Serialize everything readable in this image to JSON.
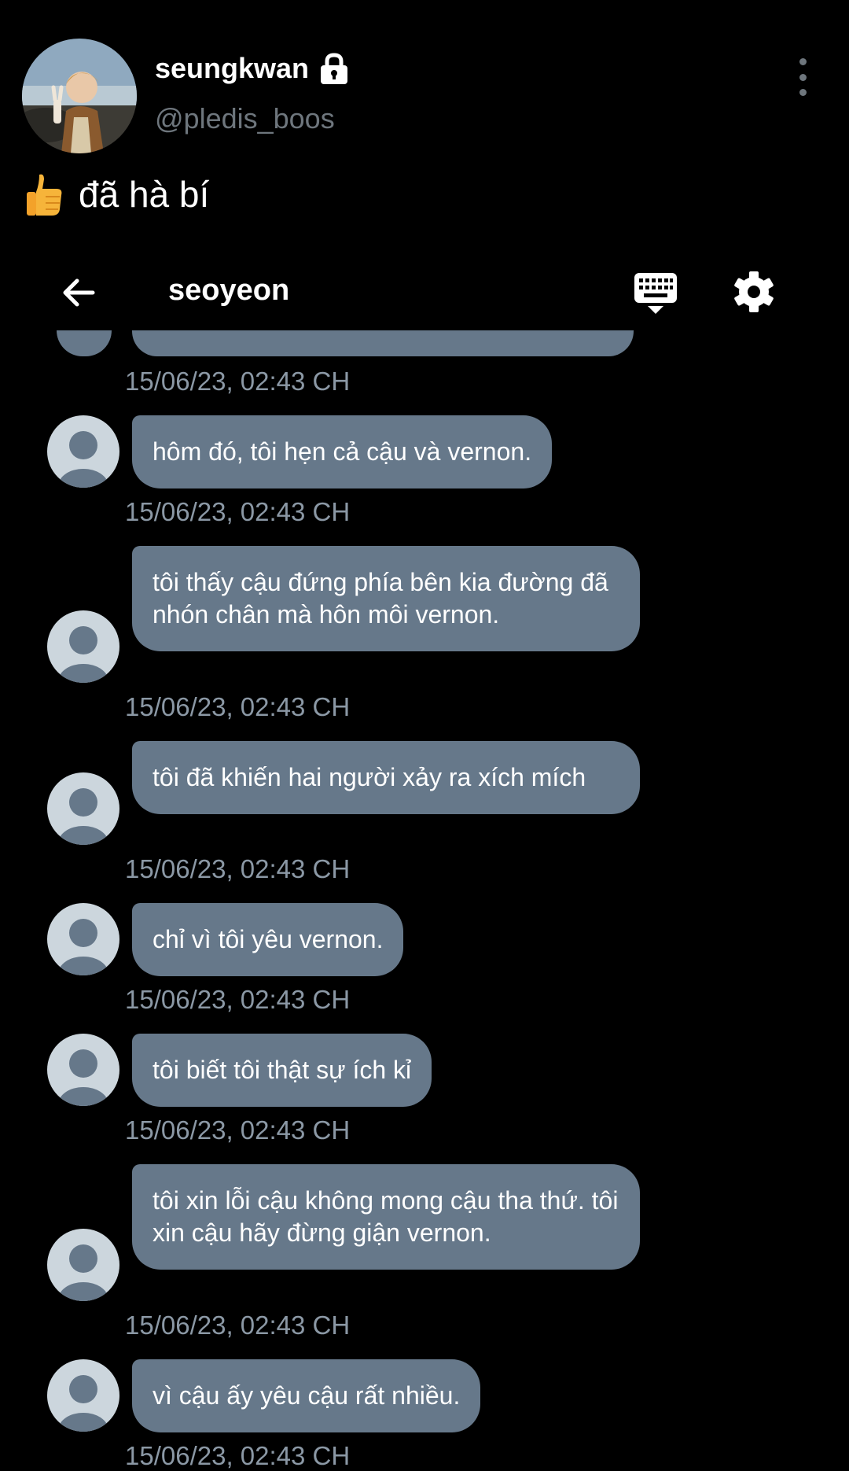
{
  "tweet": {
    "display_name": "seungkwan",
    "handle": "@pledis_boos",
    "text": "đã hà bí",
    "avatar": "profile-photo",
    "verified_icon": "lock-icon",
    "emoji": "thumbs-up-icon"
  },
  "chat": {
    "title": "seoyeon",
    "back_icon": "arrow-left-icon",
    "keyboard_icon": "keyboard-icon",
    "settings_icon": "gear-icon",
    "top_timestamp": "15/06/23, 02:43 CH",
    "messages": [
      {
        "text": "hôm đó, tôi hẹn cả cậu và vernon.",
        "time": "15/06/23, 02:43 CH"
      },
      {
        "text": "tôi thấy cậu đứng phía bên kia đường đã nhón chân mà hôn môi vernon.",
        "time": "15/06/23, 02:43 CH"
      },
      {
        "text": "tôi đã khiến hai người xảy ra xích mích",
        "time": "15/06/23, 02:43 CH"
      },
      {
        "text": "chỉ vì tôi yêu vernon.",
        "time": "15/06/23, 02:43 CH"
      },
      {
        "text": "tôi biết tôi thật sự ích kỉ",
        "time": "15/06/23, 02:43 CH"
      },
      {
        "text": "tôi xin lỗi cậu không mong cậu tha thứ. tôi xin cậu hãy đừng giận vernon.",
        "time": "15/06/23, 02:43 CH"
      },
      {
        "text": "vì cậu ấy yêu cậu rất nhiều.",
        "time": "15/06/23, 02:43 CH"
      }
    ]
  },
  "colors": {
    "background": "#000000",
    "bubble": "#66788a",
    "timestamp": "#8b98a5",
    "handle": "#6e767d",
    "avatar_placeholder": "#ccd6dd"
  }
}
